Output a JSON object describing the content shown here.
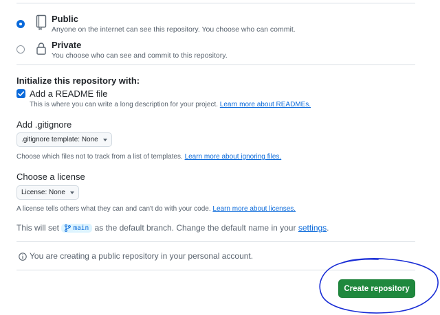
{
  "visibility": {
    "public": {
      "title": "Public",
      "description": "Anyone on the internet can see this repository. You choose who can commit.",
      "selected": true
    },
    "private": {
      "title": "Private",
      "description": "You choose who can see and commit to this repository.",
      "selected": false
    }
  },
  "initialize": {
    "heading": "Initialize this repository with:",
    "readme": {
      "label": "Add a README file",
      "checked": true,
      "description": "This is where you can write a long description for your project.",
      "link": "Learn more about READMEs."
    }
  },
  "gitignore": {
    "heading": "Add .gitignore",
    "dropdown_label": ".gitignore template: None",
    "description": "Choose which files not to track from a list of templates.",
    "link": "Learn more about ignoring files."
  },
  "license": {
    "heading": "Choose a license",
    "dropdown_label": "License: None",
    "description": "A license tells others what they can and can't do with your code.",
    "link": "Learn more about licenses."
  },
  "branch_note": {
    "prefix": "This will set",
    "branch": "main",
    "middle": "as the default branch. Change the default name in your",
    "link": "settings",
    "suffix": "."
  },
  "info_message": "You are creating a public repository in your personal account.",
  "create_button": "Create repository",
  "colors": {
    "accent": "#0969da",
    "primary_button": "#1f883d",
    "annotation_circle": "#1b2fd6"
  },
  "icons": {
    "public": "repo-icon",
    "private": "lock-icon",
    "info": "info-icon",
    "branch": "git-branch-icon"
  }
}
